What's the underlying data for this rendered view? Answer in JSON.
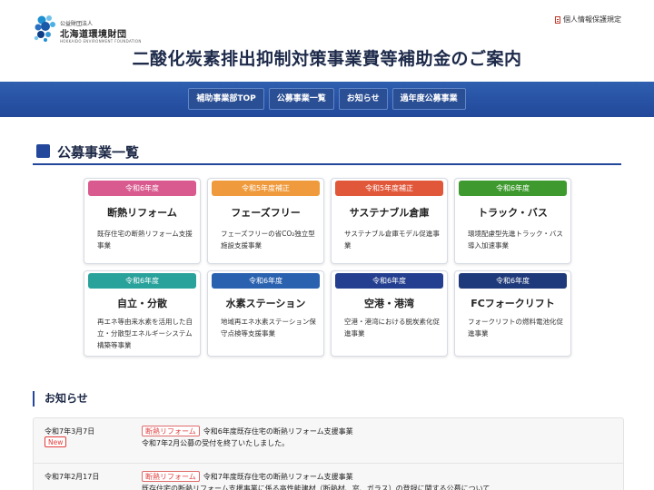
{
  "logo": {
    "small": "公益財団法人",
    "name": "北海道環境財団",
    "en": "HOKKAIDO ENVIRONMENT FOUNDATION"
  },
  "header": {
    "privacy": "個人情報保護規定",
    "title": "二酸化炭素排出抑制対策事業費等補助金のご案内"
  },
  "nav": {
    "items": [
      {
        "label": "補助事業部TOP"
      },
      {
        "label": "公募事業一覧"
      },
      {
        "label": "お知らせ"
      },
      {
        "label": "過年度公募事業"
      }
    ]
  },
  "section": {
    "title": "公募事業一覧"
  },
  "cards": [
    {
      "tag": "令和6年度",
      "color": "#d85a8f",
      "title": "断熱リフォーム",
      "desc": "既存住宅の断熱リフォーム支援事業"
    },
    {
      "tag": "令和5年度補正",
      "color": "#ef9a3c",
      "title": "フェーズフリー",
      "desc": "フェーズフリーの省CO₂独立型施設支援事業"
    },
    {
      "tag": "令和5年度補正",
      "color": "#e1573a",
      "title": "サステナブル倉庫",
      "desc": "サステナブル倉庫モデル促進事業"
    },
    {
      "tag": "令和6年度",
      "color": "#3e9a2e",
      "title": "トラック・バス",
      "desc": "環境配慮型先進トラック・バス導入加速事業"
    },
    {
      "tag": "令和6年度",
      "color": "#2aa29c",
      "title": "自立・分散",
      "desc": "再エネ等由来水素を活用した自立・分散型エネルギーシステム構築等事業"
    },
    {
      "tag": "令和6年度",
      "color": "#2a62b0",
      "title": "水素ステーション",
      "desc": "地域再エネ水素ステーション保守点検等支援事業"
    },
    {
      "tag": "令和6年度",
      "color": "#243f8f",
      "title": "空港・港湾",
      "desc": "空港・港湾における脱炭素化促進事業"
    },
    {
      "tag": "令和6年度",
      "color": "#1f3a7a",
      "title": "FCフォークリフト",
      "desc": "フォークリフトの燃料電池化促進事業"
    }
  ],
  "news": {
    "title": "お知らせ",
    "items": [
      {
        "date": "令和7年3月7日",
        "badge": "New",
        "category": "断熱リフォーム",
        "line1": "令和6年度既存住宅の断熱リフォーム支援事業",
        "line2": "令和7年2月公募の受付を終了いたしました。"
      },
      {
        "date": "令和7年2月17日",
        "badge": "",
        "category": "断熱リフォーム",
        "line1": "令和7年度既存住宅の断熱リフォーム支援事業",
        "line2": "既存住宅の断熱リフォーム支援事業に係る高性能建材（断熱材、窓、ガラス）の登録に関する公募について"
      }
    ]
  }
}
